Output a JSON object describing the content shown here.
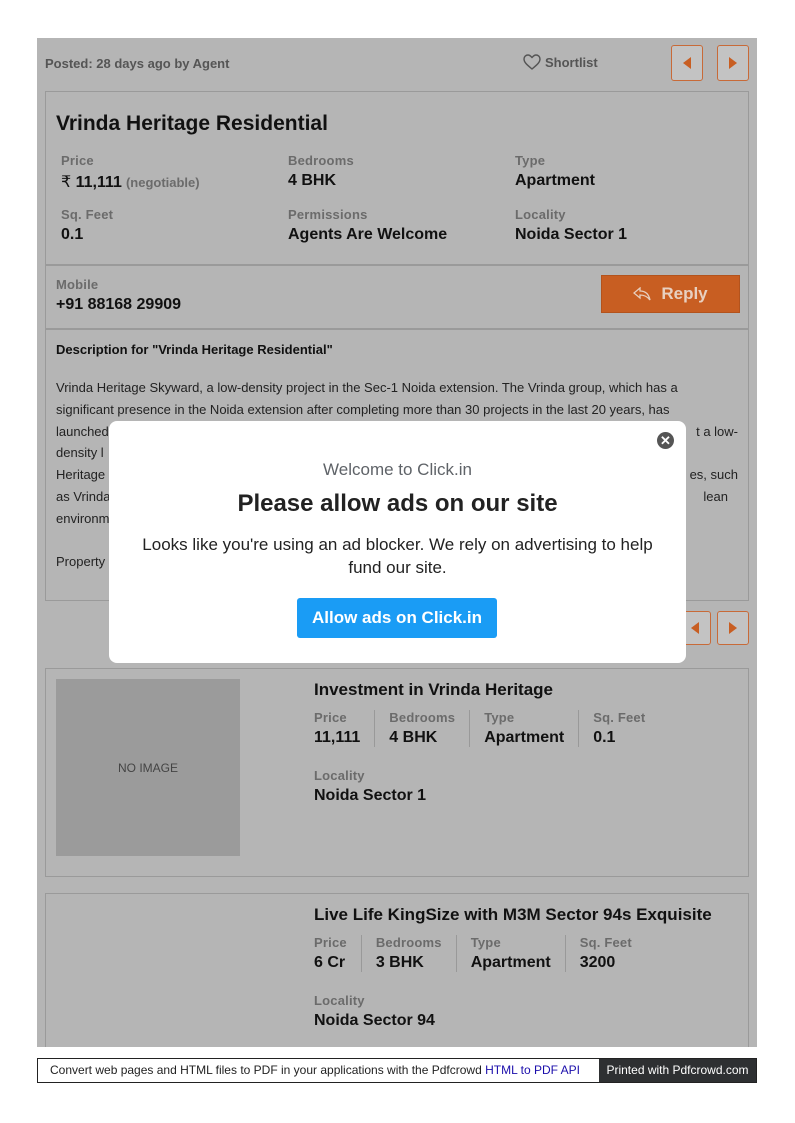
{
  "header": {
    "posted": "Posted: 28 days ago by Agent",
    "shortlist": "Shortlist"
  },
  "listing": {
    "title": "Vrinda Heritage Residential",
    "price_label": "Price",
    "price_currency": "₹",
    "price_value": "11,111",
    "price_note": "(negotiable)",
    "bedrooms_label": "Bedrooms",
    "bedrooms_value": "4 BHK",
    "type_label": "Type",
    "type_value": "Apartment",
    "sqft_label": "Sq. Feet",
    "sqft_value": "0.1",
    "permissions_label": "Permissions",
    "permissions_value": "Agents Are Welcome",
    "locality_label": "Locality",
    "locality_value": "Noida Sector 1"
  },
  "contact": {
    "mobile_label": "Mobile",
    "mobile_value": "+91 88168 29909",
    "reply_label": "Reply"
  },
  "description": {
    "title": "Description for \"Vrinda Heritage Residential\"",
    "lines": [
      "Vrinda Heritage Skyward, a low-density project in the Sec-1 Noida extension. The Vrinda group, which has a",
      "significant presence in the Noida extension after completing more than 30 projects in the last 20 years, has",
      "launched",
      "density l",
      "Heritage",
      "as Vrinda",
      "environm"
    ],
    "line_right_3": "t a low-",
    "line_right_5": "es, such",
    "line_right_6": "lean",
    "property_fragment": "Property"
  },
  "modal": {
    "close": "✕",
    "welcome": "Welcome to Click.in",
    "title": "Please allow ads on our site",
    "text": "Looks like you're using an ad blocker. We rely on advertising to help fund our site.",
    "button": "Allow ads on Click.in"
  },
  "related": [
    {
      "title": "Investment in Vrinda Heritage",
      "image_text": "NO IMAGE",
      "price_label": "Price",
      "price": "11,111",
      "bedrooms_label": "Bedrooms",
      "bedrooms": "4 BHK",
      "type_label": "Type",
      "type": "Apartment",
      "sqft_label": "Sq. Feet",
      "sqft": "0.1",
      "locality_label": "Locality",
      "locality": "Noida Sector 1"
    },
    {
      "title": "Live Life KingSize with M3M Sector 94s Exquisite",
      "price_label": "Price",
      "price": "6 Cr",
      "bedrooms_label": "Bedrooms",
      "bedrooms": "3 BHK",
      "type_label": "Type",
      "type": "Apartment",
      "sqft_label": "Sq. Feet",
      "sqft": "3200",
      "locality_label": "Locality",
      "locality": "Noida Sector 94"
    }
  ],
  "footer": {
    "text": "Convert web pages and HTML files to PDF in your applications with the Pdfcrowd",
    "link": "HTML to PDF API",
    "printed": "Printed with Pdfcrowd.com"
  },
  "colors": {
    "accent": "#c85e22",
    "allow_button": "#1a9cf5",
    "page_bg": "#b5b5b5"
  }
}
